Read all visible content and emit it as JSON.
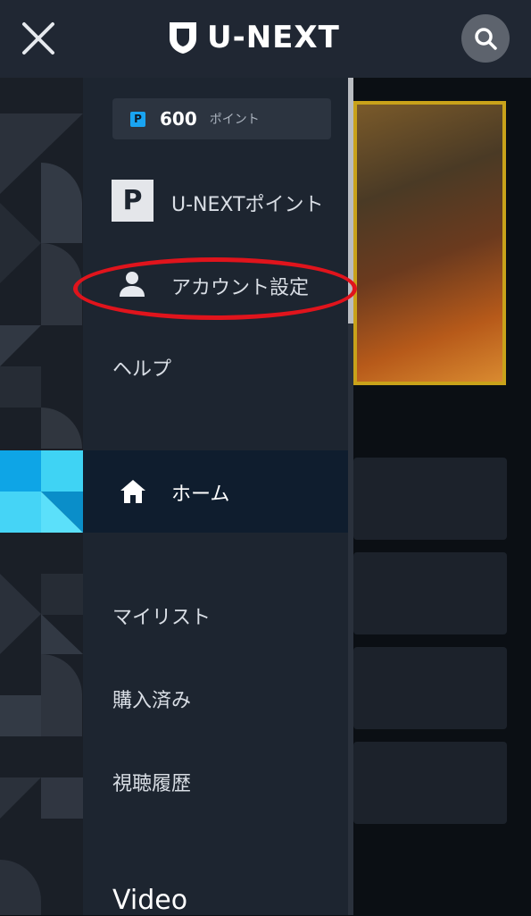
{
  "header": {
    "logo_text": "U-NEXT",
    "close_icon": "close-icon",
    "search_icon": "search-icon"
  },
  "drawer": {
    "points": {
      "badge": "P",
      "value": "600",
      "unit": "ポイント"
    },
    "points_menu": {
      "icon_letter": "P",
      "label": "U-NEXTポイント"
    },
    "account_settings": {
      "icon": "user-icon",
      "label": "アカウント設定"
    },
    "help": {
      "label": "ヘルプ"
    },
    "home": {
      "icon": "home-icon",
      "label": "ホーム"
    },
    "my_list": {
      "label": "マイリスト"
    },
    "purchased": {
      "label": "購入済み"
    },
    "history": {
      "label": "視聴履歴"
    },
    "section_video": {
      "label": "Video"
    }
  },
  "colors": {
    "header_bg": "#202733",
    "drawer_bg": "#1d2530",
    "home_active_bg": "#0f1d2e",
    "accent_blue": "#19a4f2",
    "highlight_red": "#e0141c"
  }
}
